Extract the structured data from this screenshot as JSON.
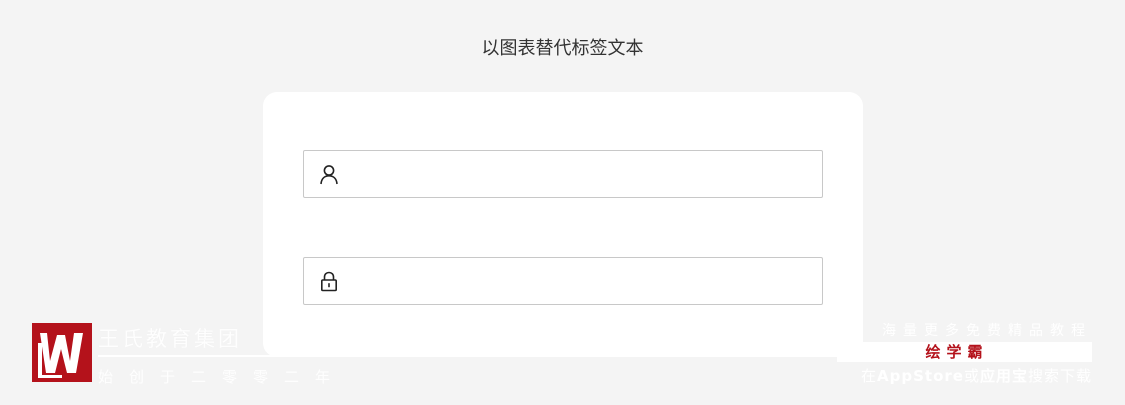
{
  "header": {
    "title": "以图表替代标签文本"
  },
  "login_form": {
    "username": {
      "icon": "user-icon",
      "value": "",
      "placeholder": ""
    },
    "password": {
      "icon": "lock-icon",
      "value": "",
      "placeholder": ""
    }
  },
  "watermark_left": {
    "logo": "W",
    "title": "王氏教育集团",
    "subtitle": "始创于二零零二年"
  },
  "watermark_right": {
    "top_line": "海量更多免费精品教程",
    "brand": "绘学霸",
    "bottom_prefix": "在",
    "bottom_appstore": "AppStore",
    "bottom_or": "或",
    "bottom_yyb": "应用宝",
    "bottom_suffix": "搜索下载"
  },
  "colors": {
    "background": "#f4f4f4",
    "card": "#ffffff",
    "input_border": "#c8c8c8",
    "brand_red": "#b4121b"
  }
}
